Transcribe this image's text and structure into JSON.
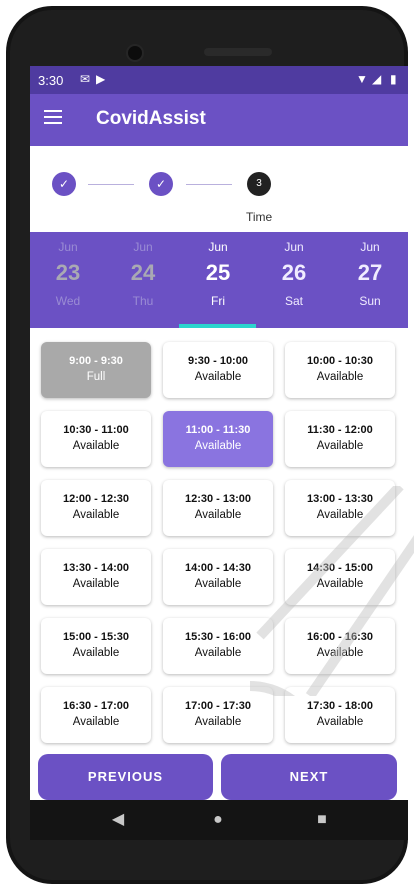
{
  "status_bar": {
    "time": "3:30",
    "mail_icon": "mail-icon",
    "play_icon": "play-store-icon",
    "wifi_icon": "wifi-icon",
    "signal_icon": "signal-icon",
    "battery_icon": "battery-icon"
  },
  "app_bar": {
    "title": "CovidAssist",
    "menu_icon": "hamburger-menu-icon"
  },
  "stepper": {
    "steps": [
      {
        "state": "done",
        "glyph": "✓"
      },
      {
        "state": "done",
        "glyph": "✓"
      },
      {
        "state": "active",
        "number": "3",
        "label": "Time"
      }
    ]
  },
  "dates": [
    {
      "month": "Jun",
      "day": "23",
      "weekday": "Wed",
      "state": "past"
    },
    {
      "month": "Jun",
      "day": "24",
      "weekday": "Thu",
      "state": "past"
    },
    {
      "month": "Jun",
      "day": "25",
      "weekday": "Fri",
      "state": "selected"
    },
    {
      "month": "Jun",
      "day": "26",
      "weekday": "Sat",
      "state": "future"
    },
    {
      "month": "Jun",
      "day": "27",
      "weekday": "Sun",
      "state": "future"
    }
  ],
  "slots": [
    {
      "time": "9:00 - 9:30",
      "status": "Full",
      "state": "full"
    },
    {
      "time": "9:30 - 10:00",
      "status": "Available",
      "state": "available"
    },
    {
      "time": "10:00 - 10:30",
      "status": "Available",
      "state": "available"
    },
    {
      "time": "10:30 - 11:00",
      "status": "Available",
      "state": "available"
    },
    {
      "time": "11:00 - 11:30",
      "status": "Available",
      "state": "selected"
    },
    {
      "time": "11:30 - 12:00",
      "status": "Available",
      "state": "available"
    },
    {
      "time": "12:00 - 12:30",
      "status": "Available",
      "state": "available"
    },
    {
      "time": "12:30 - 13:00",
      "status": "Available",
      "state": "available"
    },
    {
      "time": "13:00 - 13:30",
      "status": "Available",
      "state": "available"
    },
    {
      "time": "13:30 - 14:00",
      "status": "Available",
      "state": "available"
    },
    {
      "time": "14:00 - 14:30",
      "status": "Available",
      "state": "available"
    },
    {
      "time": "14:30 - 15:00",
      "status": "Available",
      "state": "available"
    },
    {
      "time": "15:00 - 15:30",
      "status": "Available",
      "state": "available"
    },
    {
      "time": "15:30 - 16:00",
      "status": "Available",
      "state": "available"
    },
    {
      "time": "16:00 - 16:30",
      "status": "Available",
      "state": "available"
    },
    {
      "time": "16:30 - 17:00",
      "status": "Available",
      "state": "available"
    },
    {
      "time": "17:00 - 17:30",
      "status": "Available",
      "state": "available"
    },
    {
      "time": "17:30 - 18:00",
      "status": "Available",
      "state": "available"
    }
  ],
  "buttons": {
    "previous": "PREVIOUS",
    "next": "NEXT"
  },
  "nav_bar": {
    "back": "◀",
    "home": "●",
    "recents": "■"
  },
  "colors": {
    "primary": "#6b51c4",
    "status_bar": "#4f3ba0",
    "indicator": "#2cd5cd",
    "selected_slot": "#8a74e0",
    "full_slot": "#a9a9a9"
  }
}
